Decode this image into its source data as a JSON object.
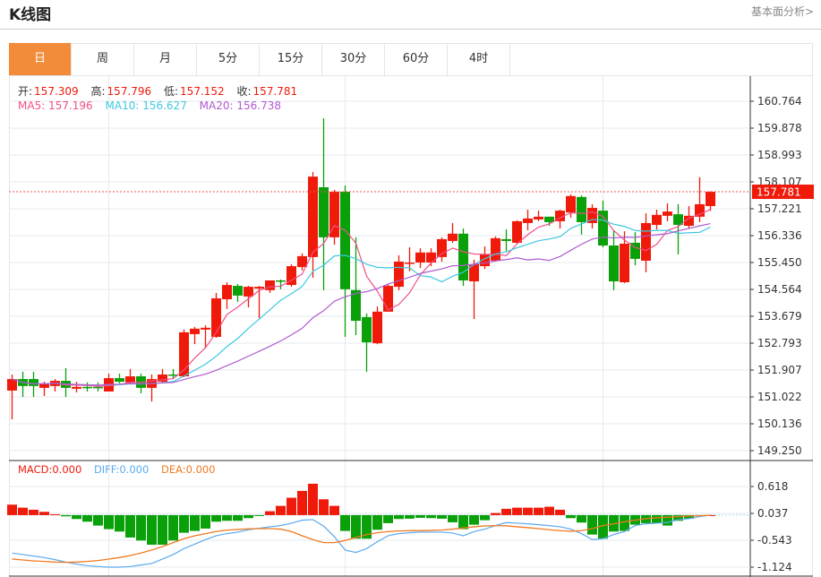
{
  "header": {
    "title": "K线图",
    "link": "基本面分析>"
  },
  "tabs": [
    {
      "label": "日",
      "active": true
    },
    {
      "label": "周"
    },
    {
      "label": "月"
    },
    {
      "label": "5分"
    },
    {
      "label": "15分"
    },
    {
      "label": "30分"
    },
    {
      "label": "60分"
    },
    {
      "label": "4时"
    }
  ],
  "ohlc_legend": {
    "open_label": "开:",
    "open": "157.309",
    "high_label": "高:",
    "high": "157.796",
    "low_label": "低:",
    "low": "157.152",
    "close_label": "收:",
    "close": "157.781"
  },
  "ma_legend": {
    "ma5": "MA5: 157.196",
    "ma10": "MA10: 156.627",
    "ma20": "MA20: 156.738"
  },
  "macd_legend": {
    "macd": "MACD:0.000",
    "diff": "DIFF:0.000",
    "dea": "DEA:0.000"
  },
  "colors": {
    "up": "#f01a0a",
    "down": "#0aa00a",
    "ma5": "#f0508a",
    "ma10": "#3ec8e0",
    "ma20": "#b05ad0",
    "diff": "#5aaaf0",
    "dea": "#f07a20",
    "accent": "#f28c3a"
  },
  "chart_data": [
    {
      "type": "candlestick",
      "title": "K线图",
      "ylim": [
        149.25,
        160.764
      ],
      "yticks": [
        "160.764",
        "159.878",
        "158.993",
        "158.107",
        "157.221",
        "156.336",
        "155.450",
        "154.564",
        "153.679",
        "152.793",
        "151.907",
        "151.022",
        "150.136",
        "149.250"
      ],
      "current_price": "157.781",
      "grid": true,
      "candles_ohlc": [
        [
          151.23,
          151.61,
          151.76,
          150.28
        ],
        [
          151.61,
          151.38,
          151.85,
          151.02
        ],
        [
          151.61,
          151.38,
          151.85,
          151.02
        ],
        [
          151.32,
          151.44,
          151.52,
          151.05
        ],
        [
          151.38,
          151.55,
          151.61,
          151.2
        ],
        [
          151.55,
          151.32,
          151.97,
          151.02
        ],
        [
          151.29,
          151.35,
          151.52,
          151.17
        ],
        [
          151.35,
          151.32,
          151.5,
          151.2
        ],
        [
          151.35,
          151.32,
          151.5,
          151.2
        ],
        [
          151.2,
          151.64,
          151.79,
          151.2
        ],
        [
          151.64,
          151.52,
          151.79,
          151.47
        ],
        [
          151.5,
          151.7,
          151.94,
          151.47
        ],
        [
          151.7,
          151.32,
          151.79,
          151.14
        ],
        [
          151.32,
          151.61,
          151.76,
          150.87
        ],
        [
          151.52,
          151.76,
          151.94,
          151.5
        ],
        [
          151.76,
          151.73,
          151.94,
          151.61
        ],
        [
          151.7,
          153.15,
          153.24,
          151.67
        ],
        [
          153.09,
          153.27,
          153.33,
          152.76
        ],
        [
          153.24,
          153.3,
          153.38,
          152.62
        ],
        [
          153.0,
          154.27,
          154.45,
          152.97
        ],
        [
          154.24,
          154.71,
          154.8,
          153.92
        ],
        [
          154.68,
          154.36,
          154.74,
          154.15
        ],
        [
          154.33,
          154.65,
          154.68,
          153.97
        ],
        [
          154.59,
          154.65,
          154.68,
          153.62
        ],
        [
          154.54,
          154.86,
          154.86,
          154.45
        ],
        [
          154.86,
          154.83,
          154.89,
          154.57
        ],
        [
          154.71,
          155.33,
          155.39,
          154.65
        ],
        [
          155.3,
          155.66,
          155.75,
          155.19
        ],
        [
          155.63,
          158.28,
          158.43,
          154.95
        ],
        [
          157.93,
          156.28,
          160.2,
          154.54
        ],
        [
          156.28,
          157.78,
          157.84,
          156.04
        ],
        [
          157.78,
          154.57,
          157.99,
          153.0
        ],
        [
          154.54,
          153.53,
          156.28,
          153.06
        ],
        [
          153.65,
          152.82,
          153.77,
          151.85
        ],
        [
          152.79,
          153.83,
          154.0,
          152.76
        ],
        [
          153.83,
          154.68,
          154.74,
          153.83
        ],
        [
          154.65,
          155.48,
          155.69,
          154.54
        ],
        [
          155.42,
          155.45,
          155.95,
          155.16
        ],
        [
          155.45,
          155.78,
          155.92,
          155.27
        ],
        [
          155.45,
          155.78,
          155.92,
          155.33
        ],
        [
          155.63,
          156.22,
          156.28,
          155.48
        ],
        [
          156.16,
          156.4,
          156.75,
          156.1
        ],
        [
          156.4,
          154.86,
          156.57,
          154.68
        ],
        [
          154.83,
          155.39,
          155.54,
          153.59
        ],
        [
          155.33,
          155.72,
          155.98,
          155.24
        ],
        [
          155.51,
          156.25,
          156.31,
          155.48
        ],
        [
          156.22,
          156.16,
          156.54,
          155.83
        ],
        [
          156.1,
          156.81,
          156.84,
          156.07
        ],
        [
          156.75,
          156.9,
          157.19,
          156.51
        ],
        [
          156.87,
          156.96,
          157.16,
          156.81
        ],
        [
          156.96,
          156.78,
          156.96,
          156.66
        ],
        [
          156.81,
          157.16,
          157.19,
          156.57
        ],
        [
          157.1,
          157.64,
          157.69,
          156.93
        ],
        [
          157.61,
          156.78,
          157.66,
          156.37
        ],
        [
          156.75,
          157.25,
          157.37,
          156.57
        ],
        [
          157.16,
          156.01,
          157.49,
          155.95
        ],
        [
          156.01,
          154.83,
          156.51,
          154.54
        ],
        [
          154.8,
          156.07,
          156.48,
          154.77
        ],
        [
          156.1,
          155.57,
          156.45,
          155.36
        ],
        [
          155.51,
          156.75,
          157.07,
          155.13
        ],
        [
          156.69,
          157.02,
          157.19,
          156.54
        ],
        [
          156.99,
          157.13,
          157.4,
          156.81
        ],
        [
          157.04,
          156.69,
          157.37,
          155.72
        ],
        [
          156.66,
          156.99,
          157.31,
          156.57
        ],
        [
          156.96,
          157.37,
          158.26,
          156.78
        ],
        [
          157.309,
          157.781,
          157.796,
          157.152
        ]
      ],
      "ma_periods": [
        5,
        10,
        20
      ]
    },
    {
      "type": "bar+line",
      "title": "MACD",
      "ylim": [
        -1.124,
        0.618
      ],
      "yticks": [
        "0.618",
        "0.037",
        "-0.543",
        "-1.124"
      ],
      "macd": [
        0.226,
        0.161,
        0.116,
        0.071,
        0.019,
        -0.026,
        -0.084,
        -0.142,
        -0.226,
        -0.303,
        -0.355,
        -0.484,
        -0.549,
        -0.639,
        -0.639,
        -0.549,
        -0.381,
        -0.342,
        -0.291,
        -0.142,
        -0.123,
        -0.123,
        -0.065,
        -0.019,
        0.084,
        0.2,
        0.375,
        0.523,
        0.678,
        0.342,
        0.2,
        -0.342,
        -0.51,
        -0.51,
        -0.316,
        -0.174,
        -0.084,
        -0.077,
        -0.058,
        -0.065,
        -0.077,
        -0.155,
        -0.303,
        -0.207,
        -0.11,
        0.045,
        0.136,
        0.161,
        0.161,
        0.161,
        0.181,
        0.116,
        -0.065,
        -0.161,
        -0.42,
        -0.51,
        -0.355,
        -0.342,
        -0.207,
        -0.174,
        -0.174,
        -0.226,
        -0.123,
        -0.077,
        -0.019,
        0.0
      ],
      "diff": [
        -0.82,
        -0.852,
        -0.885,
        -0.917,
        -0.962,
        -1.014,
        -1.059,
        -1.091,
        -1.111,
        -1.124,
        -1.124,
        -1.111,
        -1.078,
        -1.046,
        -0.949,
        -0.852,
        -0.723,
        -0.626,
        -0.529,
        -0.446,
        -0.4,
        -0.368,
        -0.316,
        -0.284,
        -0.252,
        -0.226,
        -0.174,
        -0.11,
        -0.097,
        -0.239,
        -0.465,
        -0.755,
        -0.807,
        -0.723,
        -0.575,
        -0.446,
        -0.4,
        -0.381,
        -0.368,
        -0.368,
        -0.368,
        -0.387,
        -0.446,
        -0.355,
        -0.303,
        -0.226,
        -0.161,
        -0.174,
        -0.187,
        -0.207,
        -0.226,
        -0.252,
        -0.303,
        -0.4,
        -0.529,
        -0.51,
        -0.42,
        -0.355,
        -0.226,
        -0.187,
        -0.174,
        -0.161,
        -0.097,
        -0.077,
        -0.032,
        0.0
      ],
      "dea": [
        -0.949,
        -0.969,
        -0.988,
        -1.001,
        -1.014,
        -1.02,
        -1.014,
        -1.001,
        -0.981,
        -0.949,
        -0.917,
        -0.872,
        -0.82,
        -0.755,
        -0.678,
        -0.594,
        -0.51,
        -0.446,
        -0.4,
        -0.355,
        -0.323,
        -0.31,
        -0.297,
        -0.291,
        -0.291,
        -0.303,
        -0.355,
        -0.446,
        -0.529,
        -0.594,
        -0.594,
        -0.549,
        -0.484,
        -0.42,
        -0.381,
        -0.355,
        -0.342,
        -0.336,
        -0.336,
        -0.329,
        -0.323,
        -0.303,
        -0.278,
        -0.252,
        -0.232,
        -0.226,
        -0.232,
        -0.252,
        -0.271,
        -0.291,
        -0.316,
        -0.336,
        -0.349,
        -0.336,
        -0.291,
        -0.226,
        -0.187,
        -0.142,
        -0.11,
        -0.077,
        -0.058,
        -0.045,
        -0.032,
        -0.019,
        -0.013,
        -0.006
      ]
    }
  ]
}
